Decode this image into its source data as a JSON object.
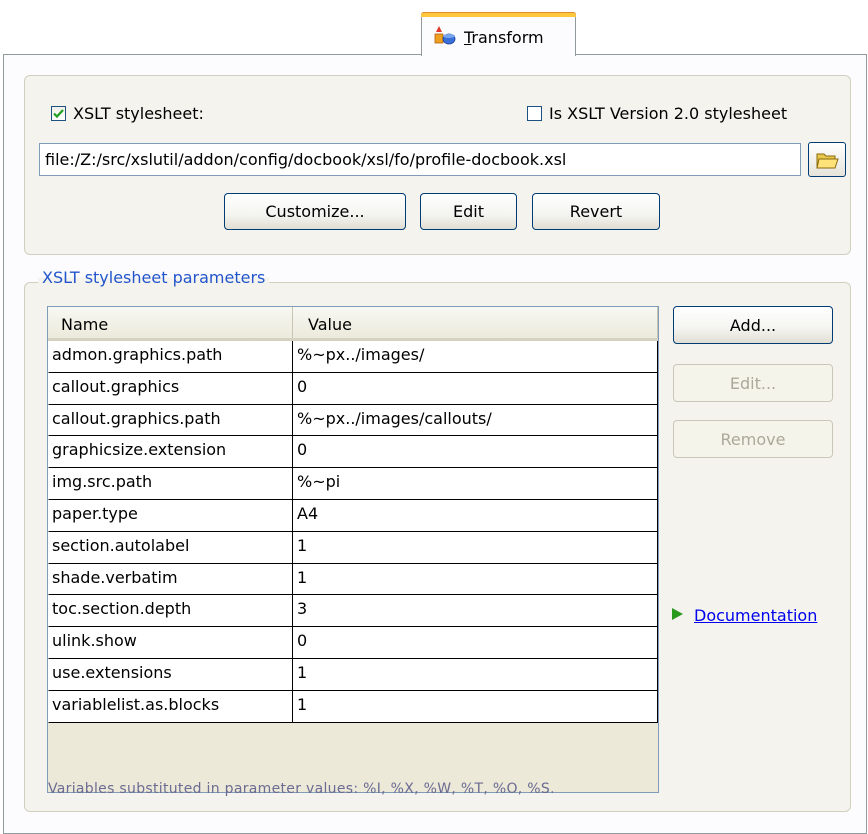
{
  "tab": {
    "label_prefix": "",
    "label_accel": "T",
    "label_rest": "ransform",
    "icon": "transform-icon"
  },
  "stylesheet": {
    "checkbox_label": "XSLT stylesheet:",
    "checked": true,
    "version2_label": "Is XSLT Version 2.0 stylesheet",
    "version2_checked": false,
    "url": "file:/Z:/src/xslutil/addon/config/docbook/xsl/fo/profile-docbook.xsl",
    "browse_icon": "folder-open-icon",
    "buttons": {
      "customize": "Customize...",
      "edit": "Edit",
      "revert": "Revert"
    }
  },
  "params": {
    "group_title": "XSLT stylesheet parameters",
    "columns": [
      "Name",
      "Value"
    ],
    "rows": [
      [
        "admon.graphics.path",
        "%~px../images/"
      ],
      [
        "callout.graphics",
        "0"
      ],
      [
        "callout.graphics.path",
        "%~px../images/callouts/"
      ],
      [
        "graphicsize.extension",
        "0"
      ],
      [
        "img.src.path",
        "%~pi"
      ],
      [
        "paper.type",
        "A4"
      ],
      [
        "section.autolabel",
        "1"
      ],
      [
        "shade.verbatim",
        "1"
      ],
      [
        "toc.section.depth",
        "3"
      ],
      [
        "ulink.show",
        "0"
      ],
      [
        "use.extensions",
        "1"
      ],
      [
        "variablelist.as.blocks",
        "1"
      ]
    ],
    "buttons": {
      "add": "Add...",
      "edit": "Edit...",
      "remove": "Remove"
    },
    "documentation_link": "Documentation",
    "footnote": "Variables substituted in parameter values: %I, %X, %W, %T, %O, %S."
  },
  "colors": {
    "accent_tab": "#ffc83c",
    "link": "#0000ee",
    "group_title": "#2255cc",
    "play_icon": "#2a9a1e"
  }
}
